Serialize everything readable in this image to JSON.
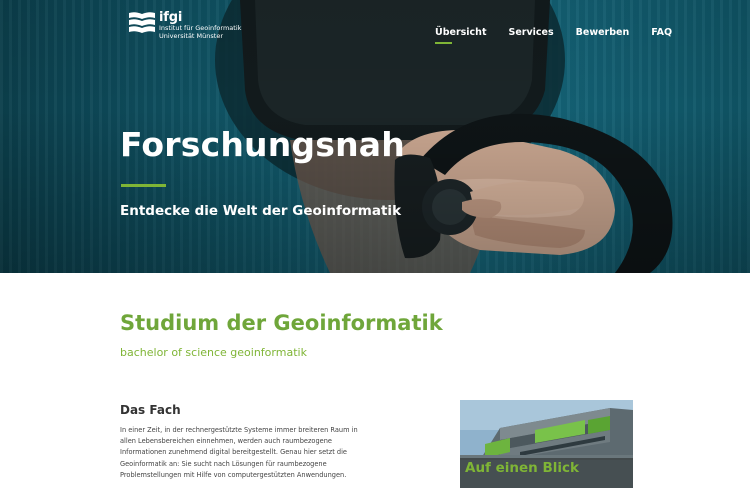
{
  "logo": {
    "name": "ifgi",
    "line1": "Institut für Geoinformatik",
    "line2": "Universität Münster",
    "icon": "ifgi-book-logo"
  },
  "nav": {
    "items": [
      {
        "label": "Übersicht",
        "active": true
      },
      {
        "label": "Services",
        "active": false
      },
      {
        "label": "Bewerben",
        "active": false
      },
      {
        "label": "FAQ",
        "active": false
      }
    ]
  },
  "hero": {
    "title": "Forschungsnah",
    "subtitle": "Entdecke die Welt der Geoinformatik"
  },
  "section": {
    "title": "Studium der Geoinformatik",
    "subtitle": "bachelor of science geoinformatik"
  },
  "fach": {
    "title": "Das Fach",
    "lines": [
      "In einer Zeit, in der rechnergestützte Systeme immer breiteren Raum in",
      "allen Lebensbereichen einnehmen, werden auch raumbezogene",
      "Informationen zunehmend digital bereitgestellt. Genau hier setzt die",
      "Geoinformatik an: Sie sucht nach Lösungen für raumbezogene",
      "Problemstellungen mit Hilfe von computergestützten Anwendungen."
    ]
  },
  "card": {
    "label": "Auf einen Blick"
  },
  "colors": {
    "accent_green": "#7fb536",
    "hero_teal": "#11586a"
  }
}
